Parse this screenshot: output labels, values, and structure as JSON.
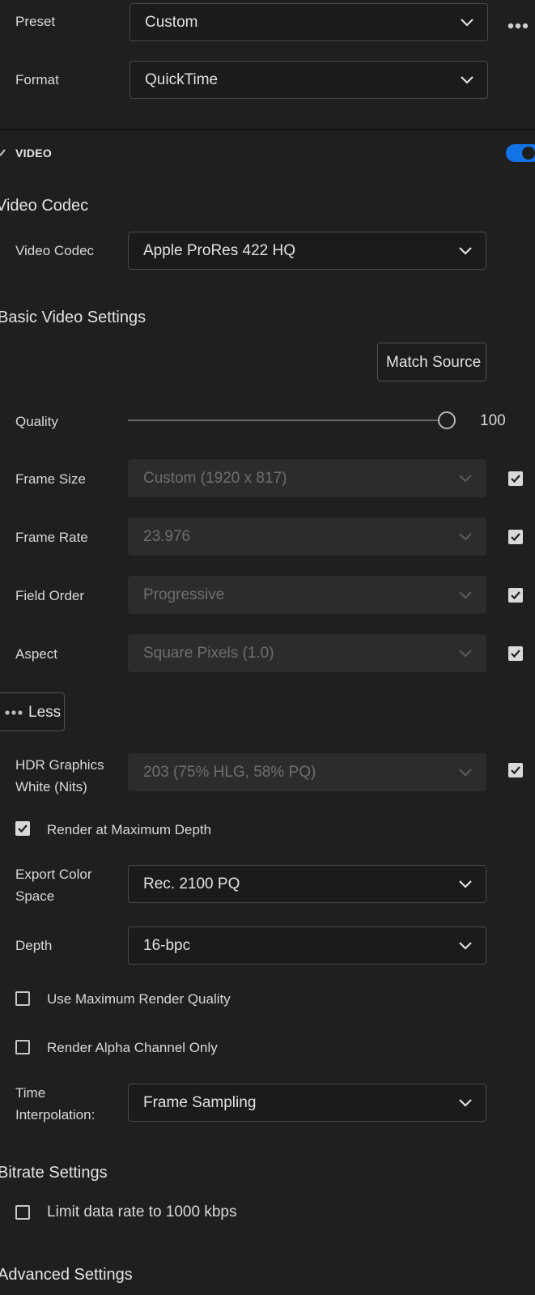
{
  "preset": {
    "label": "Preset",
    "value": "Custom"
  },
  "format": {
    "label": "Format",
    "value": "QuickTime"
  },
  "video_section": {
    "title": "VIDEO",
    "enabled": true
  },
  "video_codec_heading": "Video Codec",
  "video_codec": {
    "label": "Video Codec",
    "value": "Apple ProRes 422 HQ"
  },
  "basic_heading": "Basic Video Settings",
  "match_source_label": "Match Source",
  "quality": {
    "label": "Quality",
    "value": "100"
  },
  "frame_size": {
    "label": "Frame Size",
    "value": "Custom (1920 x 817)",
    "checked": true
  },
  "frame_rate": {
    "label": "Frame Rate",
    "value": "23.976",
    "checked": true
  },
  "field_order": {
    "label": "Field Order",
    "value": "Progressive",
    "checked": true
  },
  "aspect": {
    "label": "Aspect",
    "value": "Square Pixels (1.0)",
    "checked": true
  },
  "less_label": "Less",
  "hdr": {
    "label_line1": "HDR Graphics",
    "label_line2": "White (Nits)",
    "value": "203 (75% HLG, 58% PQ)",
    "checked": true
  },
  "render_max_depth": {
    "label": "Render at Maximum Depth",
    "checked": true
  },
  "export_color": {
    "label_line1": "Export Color",
    "label_line2": "Space",
    "value": "Rec. 2100 PQ"
  },
  "depth": {
    "label": "Depth",
    "value": "16-bpc"
  },
  "max_render_quality": {
    "label": "Use Maximum Render Quality",
    "checked": false
  },
  "alpha_only": {
    "label": "Render Alpha Channel Only",
    "checked": false
  },
  "time_interp": {
    "label_line1": "Time",
    "label_line2": "Interpolation:",
    "value": "Frame Sampling"
  },
  "bitrate_heading": "Bitrate Settings",
  "limit_data_rate": {
    "label": "Limit data rate to 1000 kbps",
    "checked": false
  },
  "advanced_heading": "Advanced Settings",
  "colors": {
    "accent": "#1473e6",
    "background": "#1f1f1f"
  }
}
